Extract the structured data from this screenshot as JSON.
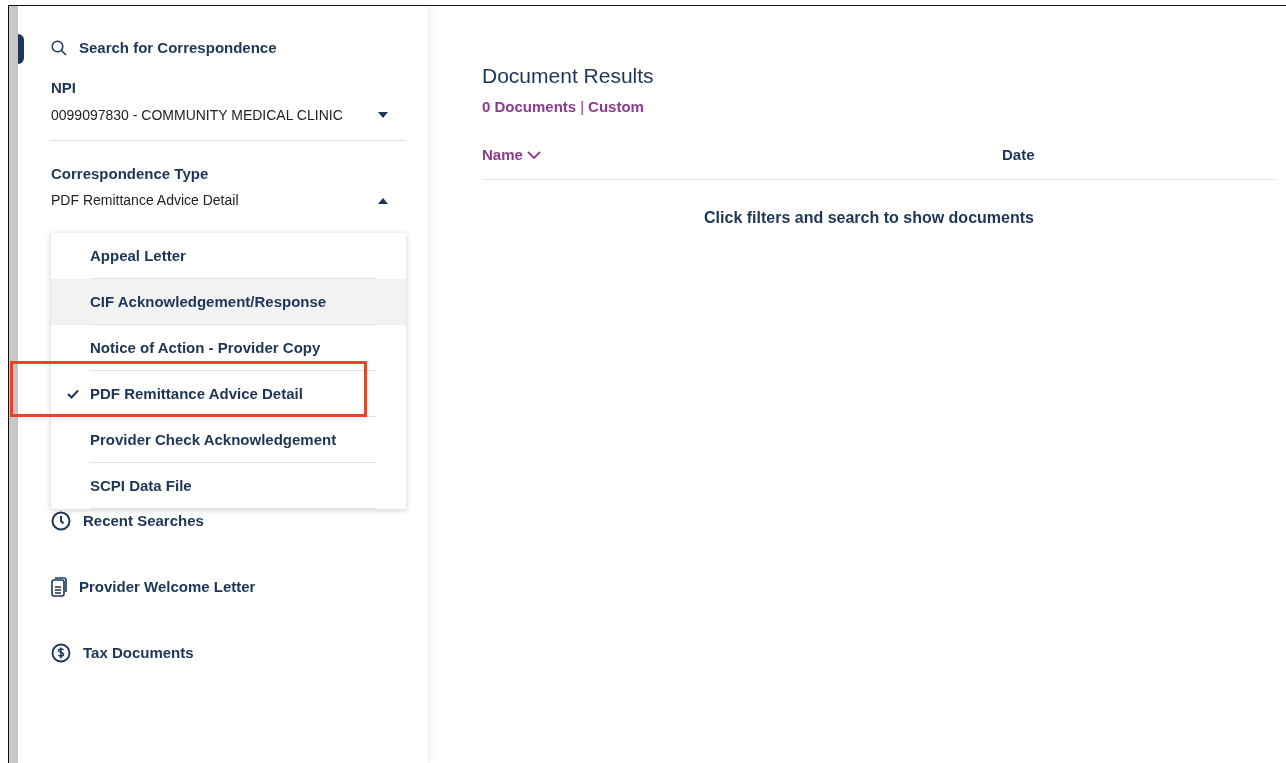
{
  "sidebar": {
    "search_heading": "Search for Correspondence",
    "npi": {
      "label": "NPI",
      "value": "0099097830 - COMMUNITY MEDICAL CLINIC",
      "expanded": false
    },
    "correspondence_type": {
      "label": "Correspondence Type",
      "value": "PDF Remittance Advice Detail",
      "expanded": true,
      "options": [
        {
          "label": "Appeal Letter",
          "selected": false,
          "hovered": false,
          "highlighted": false
        },
        {
          "label": "CIF Acknowledgement/Response",
          "selected": false,
          "hovered": true,
          "highlighted": false
        },
        {
          "label": "Notice of Action - Provider Copy",
          "selected": false,
          "hovered": false,
          "highlighted": false
        },
        {
          "label": "PDF Remittance Advice Detail",
          "selected": true,
          "hovered": false,
          "highlighted": true
        },
        {
          "label": "Provider Check Acknowledgement",
          "selected": false,
          "hovered": false,
          "highlighted": false
        },
        {
          "label": "SCPI Data File",
          "selected": false,
          "hovered": false,
          "highlighted": false
        }
      ]
    },
    "links": [
      {
        "label": "Recent Searches",
        "kind": "clock"
      },
      {
        "label": "Provider Welcome Letter",
        "kind": "document"
      },
      {
        "label": "Tax Documents",
        "kind": "dollar"
      }
    ]
  },
  "results": {
    "title": "Document Results",
    "count": "0 Documents",
    "separator": "|",
    "filter": "Custom",
    "columns": [
      {
        "label": "Name",
        "sorted": true
      },
      {
        "label": "Date",
        "sorted": false
      }
    ],
    "empty_message": "Click filters and search to show documents"
  }
}
